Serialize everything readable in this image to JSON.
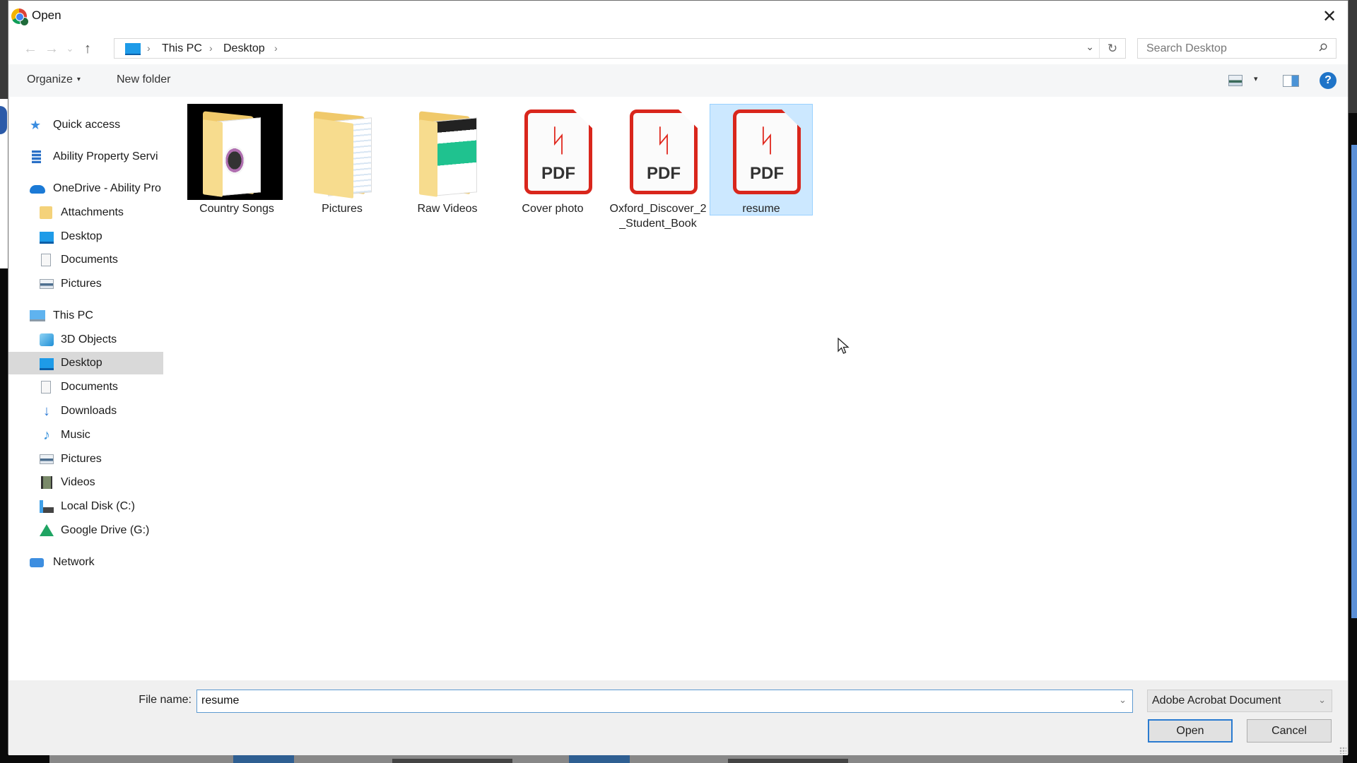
{
  "window": {
    "title": "Open",
    "close_icon": "close-icon",
    "app_icon": "chrome-icon"
  },
  "navigation": {
    "back": "←",
    "forward": "→",
    "recent": "⌄",
    "up": "↑",
    "breadcrumb": [
      "This PC",
      "Desktop"
    ],
    "breadcrumb_sep": "›",
    "dropdown": "⌄",
    "refresh": "↻",
    "search_placeholder": "Search Desktop"
  },
  "toolbar": {
    "organize": "Organize",
    "organize_caret": "▾",
    "new_folder": "New folder",
    "view_caret": "▾",
    "help": "?"
  },
  "sidebar": {
    "items": [
      {
        "label": "Quick access",
        "icon": "star-icon",
        "level": 1
      },
      {
        "label": "Ability Property Servi",
        "icon": "building-icon",
        "level": 1
      },
      {
        "label": "OneDrive - Ability Pro",
        "icon": "onedrive-icon",
        "level": 1
      },
      {
        "label": "Attachments",
        "icon": "folder-icon",
        "level": 2
      },
      {
        "label": "Desktop",
        "icon": "desktop-icon",
        "level": 2
      },
      {
        "label": "Documents",
        "icon": "documents-icon",
        "level": 2
      },
      {
        "label": "Pictures",
        "icon": "pictures-icon",
        "level": 2
      },
      {
        "label": "This PC",
        "icon": "pc-icon",
        "level": 1
      },
      {
        "label": "3D Objects",
        "icon": "3d-objects-icon",
        "level": 2
      },
      {
        "label": "Desktop",
        "icon": "desktop-icon",
        "level": 2,
        "selected": true
      },
      {
        "label": "Documents",
        "icon": "documents-icon",
        "level": 2
      },
      {
        "label": "Downloads",
        "icon": "downloads-icon",
        "level": 2
      },
      {
        "label": "Music",
        "icon": "music-icon",
        "level": 2
      },
      {
        "label": "Pictures",
        "icon": "pictures-icon",
        "level": 2
      },
      {
        "label": "Videos",
        "icon": "videos-icon",
        "level": 2
      },
      {
        "label": "Local Disk (C:)",
        "icon": "local-disk-icon",
        "level": 2
      },
      {
        "label": "Google Drive (G:)",
        "icon": "google-drive-icon",
        "level": 2
      },
      {
        "label": "Network",
        "icon": "network-icon",
        "level": 1
      }
    ]
  },
  "files": [
    {
      "name": "Country Songs",
      "type": "folder",
      "thumbnail": "music-folder"
    },
    {
      "name": "Pictures",
      "type": "folder",
      "thumbnail": "documents-folder"
    },
    {
      "name": "Raw Videos",
      "type": "folder",
      "thumbnail": "web-folder"
    },
    {
      "name": "Cover photo",
      "type": "pdf",
      "badge": "PDF"
    },
    {
      "name": "Oxford_Discover_2_Student_Book",
      "type": "pdf",
      "badge": "PDF"
    },
    {
      "name": "resume",
      "type": "pdf",
      "badge": "PDF",
      "selected": true
    }
  ],
  "footer": {
    "file_name_label": "File name:",
    "file_name_value": "resume",
    "file_type": "Adobe Acrobat Document",
    "open": "Open",
    "cancel": "Cancel",
    "caret": "⌄"
  },
  "colors": {
    "selection": "#cce8ff",
    "pdf_red": "#d9261c",
    "accent": "#2a7bd0"
  }
}
